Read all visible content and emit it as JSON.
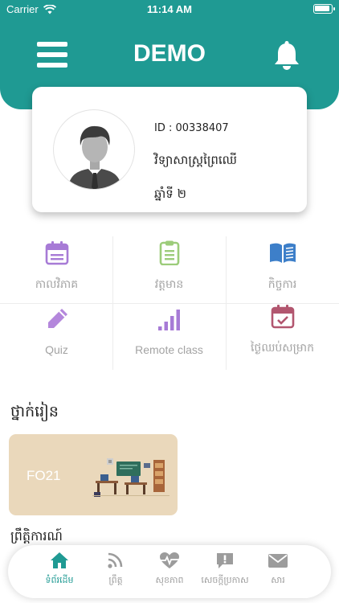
{
  "status_bar": {
    "carrier": "Carrier",
    "time": "11:14 AM"
  },
  "header": {
    "title": "DEMO",
    "menu_icon": "hamburger-menu-icon",
    "notification_icon": "bell-icon",
    "color": "#1f9a93"
  },
  "profile": {
    "id_text": "ID : 00338407",
    "school": "វិទ្យាសាស្ត្រព្រៃឈើ",
    "year": "ឆ្នាំទី ២"
  },
  "menu": {
    "items": [
      {
        "label": "កាលវិភាគ",
        "icon": "calendar-icon",
        "color": "#a77bd6"
      },
      {
        "label": "វត្តមាន",
        "icon": "clipboard-icon",
        "color": "#9ccc7a"
      },
      {
        "label": "កិច្ចការ",
        "icon": "book-icon",
        "color": "#3d7fc9"
      },
      {
        "label": "Quiz",
        "icon": "pencil-icon",
        "color": "#b487dc"
      },
      {
        "label": "Remote class",
        "icon": "signal-bars-icon",
        "color": "#a77bd6"
      },
      {
        "label": "ថ្ងៃឈប់សម្រាក",
        "icon": "calendar-check-icon",
        "color": "#b2566f"
      }
    ]
  },
  "classes": {
    "title": "ថ្នាក់រៀន",
    "items": [
      {
        "name": "FO21",
        "color": "#ead8bb"
      }
    ],
    "next_section_title": "ព្រឹត្តិការណ៍"
  },
  "bottom_nav": {
    "accent": "#1f9a93",
    "items": [
      {
        "label": "ទំព័រដើម",
        "icon": "home-icon",
        "active": true
      },
      {
        "label": "ព្រឹត្ត",
        "icon": "rss-icon",
        "active": false
      },
      {
        "label": "សុខភាព",
        "icon": "heartbeat-icon",
        "active": false
      },
      {
        "label": "សេចក្តីប្រកាស",
        "icon": "announcement-icon",
        "active": false
      },
      {
        "label": "សារ",
        "icon": "mail-icon",
        "active": false
      }
    ]
  }
}
